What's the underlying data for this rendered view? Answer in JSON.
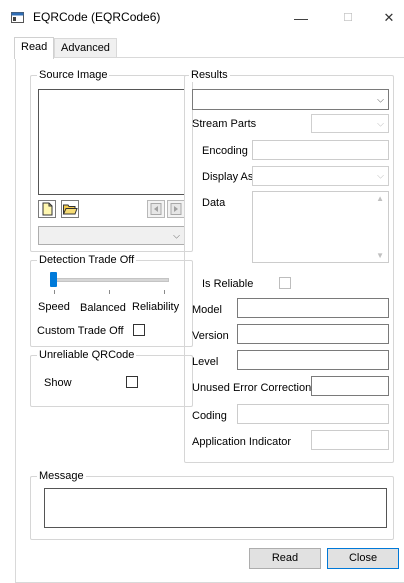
{
  "window": {
    "title": "EQRCode (EQRCode6)",
    "controls": {
      "minimize": "—",
      "maximize": "☐",
      "close": "✕"
    }
  },
  "tabs": [
    {
      "label": "Read",
      "selected": true
    },
    {
      "label": "Advanced",
      "selected": false
    }
  ],
  "source_image": {
    "group_label": "Source Image",
    "combo_value": ""
  },
  "detection": {
    "group_label": "Detection Trade Off",
    "slider_position": 0,
    "speed_label": "Speed",
    "balanced_label": "Balanced",
    "reliability_label": "Reliability",
    "custom_label": "Custom Trade Off",
    "custom_checked": false
  },
  "unreliable": {
    "group_label": "Unreliable QRCode",
    "show_label": "Show",
    "show_checked": false
  },
  "results": {
    "group_label": "Results",
    "results_value": "",
    "stream_parts_label": "Stream Parts",
    "encoding_label": "Encoding",
    "display_as_label": "Display As",
    "data_label": "Data",
    "is_reliable_label": "Is Reliable",
    "model_label": "Model",
    "version_label": "Version",
    "level_label": "Level",
    "unused_ec_label": "Unused Error Correction",
    "coding_label": "Coding",
    "app_indicator_label": "Application Indicator"
  },
  "message": {
    "group_label": "Message",
    "value": ""
  },
  "buttons": {
    "read": "Read",
    "close": "Close"
  },
  "colors": {
    "accent": "#0078d7",
    "slider_thumb": "#007ad9",
    "open_folder": "#f2c94c"
  }
}
